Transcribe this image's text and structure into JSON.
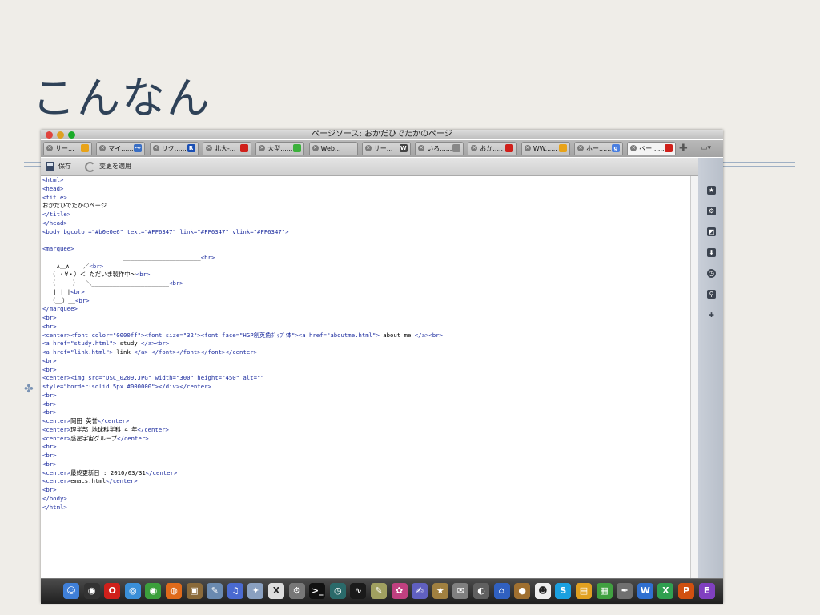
{
  "slide": {
    "title": "こんなん",
    "bullet": "✤"
  },
  "window": {
    "title": "ページソース: おかだひでたかのページ",
    "colors": {
      "close": "#e0443e",
      "minimize": "#dea123",
      "zoom": "#1aab29",
      "tag": "#1b2b9e",
      "text": "#000000"
    }
  },
  "tabs": [
    {
      "label": "サー...",
      "favicon": "tiles-icon",
      "fav_text": "",
      "fav_color": "#e8a319"
    },
    {
      "label": "マイ......",
      "favicon": "chart-icon",
      "fav_text": "〜",
      "fav_color": "#3a6fc4"
    },
    {
      "label": "リク......",
      "favicon": "r-icon",
      "fav_text": "R",
      "fav_color": "#1a4fb4"
    },
    {
      "label": "北大-...",
      "favicon": "bookmark-icon",
      "fav_text": "",
      "fav_color": "#d0201b"
    },
    {
      "label": "大型......",
      "favicon": "battery-icon",
      "fav_text": "",
      "fav_color": "#3cb13c"
    },
    {
      "label": "Web...",
      "favicon": "",
      "fav_text": "",
      "fav_color": ""
    },
    {
      "label": "サー...",
      "favicon": "wikipedia-icon",
      "fav_text": "W",
      "fav_color": "#444444"
    },
    {
      "label": "いろ......",
      "favicon": "doc-icon",
      "fav_text": "",
      "fav_color": "#888888"
    },
    {
      "label": "おか......",
      "favicon": "bookmark-icon",
      "fav_text": "",
      "fav_color": "#d0201b"
    },
    {
      "label": "WW......",
      "favicon": "tiles-icon",
      "fav_text": "",
      "fav_color": "#e8a319"
    },
    {
      "label": "ホー......",
      "favicon": "google-icon",
      "fav_text": "g",
      "fav_color": "#4a7fe0"
    },
    {
      "label": "ペー......",
      "favicon": "bookmark-icon",
      "fav_text": "",
      "fav_color": "#d0201b"
    }
  ],
  "toolbar": {
    "save_label": "保存",
    "apply_label": "変更を適用"
  },
  "source_lines": [
    [
      [
        "<html>",
        "tag"
      ]
    ],
    [
      [
        "<head>",
        "tag"
      ]
    ],
    [
      [
        "<title>",
        "tag"
      ]
    ],
    [
      [
        "おかだひでたかのページ",
        "text"
      ]
    ],
    [
      [
        "</title>",
        "tag"
      ]
    ],
    [
      [
        "</head>",
        "tag"
      ]
    ],
    [
      [
        "<body bgcolor=\"#b0e0e6\" text=\"#FF6347\" link=\"#FF6347\" vlink=\"#FF6347\">",
        "tag"
      ]
    ],
    [
      [
        "",
        "text"
      ]
    ],
    [
      [
        "<marquee>",
        "tag"
      ]
    ],
    [
      [
        "                       ______________________",
        "text"
      ],
      [
        "<br>",
        "tag"
      ]
    ],
    [
      [
        "    ∧＿∧    ／",
        "text"
      ],
      [
        "<br>",
        "tag"
      ]
    ],
    [
      [
        "  （ ・∀・）＜ ただいま製作中～",
        "text"
      ],
      [
        "<br>",
        "tag"
      ]
    ],
    [
      [
        "  （     ）  ＼______________________",
        "text"
      ],
      [
        "<br>",
        "tag"
      ]
    ],
    [
      [
        "   | | |",
        "text"
      ],
      [
        "<br>",
        "tag"
      ]
    ],
    [
      [
        "  （__）__",
        "text"
      ],
      [
        "<br>",
        "tag"
      ]
    ],
    [
      [
        "</marquee>",
        "tag"
      ]
    ],
    [
      [
        "<br>",
        "tag"
      ]
    ],
    [
      [
        "<br>",
        "tag"
      ]
    ],
    [
      [
        "<center><font color=\"0000ff\"><font size=\"32\"><font face=\"HGP創英角ﾎﾟｯﾌﾟ体\"><a href=\"aboutme.html\">",
        "tag"
      ],
      [
        " about me ",
        "text"
      ],
      [
        "</a><br>",
        "tag"
      ]
    ],
    [
      [
        "<a href=\"study.html\">",
        "tag"
      ],
      [
        " study ",
        "text"
      ],
      [
        "</a><br>",
        "tag"
      ]
    ],
    [
      [
        "<a href=\"link.html\">",
        "tag"
      ],
      [
        " link ",
        "text"
      ],
      [
        "</a> </font></font></font></center>",
        "tag"
      ]
    ],
    [
      [
        "<br>",
        "tag"
      ]
    ],
    [
      [
        "<br>",
        "tag"
      ]
    ],
    [
      [
        "<center><img src=\"DSC_0209.JPG\" width=\"300\" height=\"450\" alt=\"\"",
        "tag"
      ]
    ],
    [
      [
        "style=\"border:solid 5px #000000\"></div></center>",
        "tag"
      ]
    ],
    [
      [
        "<br>",
        "tag"
      ]
    ],
    [
      [
        "<br>",
        "tag"
      ]
    ],
    [
      [
        "<br>",
        "tag"
      ]
    ],
    [
      [
        "<center>",
        "tag"
      ],
      [
        "岡田 英誉",
        "text"
      ],
      [
        "</center>",
        "tag"
      ]
    ],
    [
      [
        "<center>",
        "tag"
      ],
      [
        "理学部 地球科学科 4 年",
        "text"
      ],
      [
        "</center>",
        "tag"
      ]
    ],
    [
      [
        "<center>",
        "tag"
      ],
      [
        "惑星宇宙グループ",
        "text"
      ],
      [
        "</center>",
        "tag"
      ]
    ],
    [
      [
        "<br>",
        "tag"
      ]
    ],
    [
      [
        "<br>",
        "tag"
      ]
    ],
    [
      [
        "<br>",
        "tag"
      ]
    ],
    [
      [
        "<center>",
        "tag"
      ],
      [
        "最終更新日 : 2010/03/31",
        "text"
      ],
      [
        "</center>",
        "tag"
      ]
    ],
    [
      [
        "<center>",
        "tag"
      ],
      [
        "emacs.html",
        "text"
      ],
      [
        "</center>",
        "tag"
      ]
    ],
    [
      [
        "<br>",
        "tag"
      ]
    ],
    [
      [
        "</body>",
        "tag"
      ]
    ],
    [
      [
        "</html>",
        "tag"
      ]
    ]
  ],
  "sidebar_icons": [
    "bookmark-star-icon",
    "gear-icon",
    "note-icon",
    "download-icon",
    "history-clock-icon",
    "search-icon",
    "add-icon"
  ],
  "dock_icons": [
    {
      "name": "finder-icon",
      "color": "#3f7fd8",
      "glyph": "☺"
    },
    {
      "name": "dashboard-icon",
      "color": "#333333",
      "glyph": "◉"
    },
    {
      "name": "opera-icon",
      "color": "#d0201b",
      "glyph": "O"
    },
    {
      "name": "safari-icon",
      "color": "#3a8fd8",
      "glyph": "◎"
    },
    {
      "name": "chrome-icon",
      "color": "#3c9f3c",
      "glyph": "◉"
    },
    {
      "name": "firefox-icon",
      "color": "#e06a1a",
      "glyph": "◍"
    },
    {
      "name": "photo-icon",
      "color": "#8a6a3a",
      "glyph": "▣"
    },
    {
      "name": "preview-icon",
      "color": "#6a8ab0",
      "glyph": "✎"
    },
    {
      "name": "itunes-icon",
      "color": "#4a6ad0",
      "glyph": "♫"
    },
    {
      "name": "app-icon",
      "color": "#8aa0c0",
      "glyph": "✦"
    },
    {
      "name": "x11-icon",
      "color": "#dddddd",
      "glyph": "X"
    },
    {
      "name": "preferences-icon",
      "color": "#777777",
      "glyph": "⚙"
    },
    {
      "name": "terminal-icon",
      "color": "#111111",
      "glyph": ">_"
    },
    {
      "name": "timemachine-icon",
      "color": "#2a6a6a",
      "glyph": "◷"
    },
    {
      "name": "activity-icon",
      "color": "#1a1a1a",
      "glyph": "∿"
    },
    {
      "name": "app-icon",
      "color": "#a0a060",
      "glyph": "✎"
    },
    {
      "name": "app-icon",
      "color": "#c04080",
      "glyph": "✿"
    },
    {
      "name": "app-icon",
      "color": "#6060c0",
      "glyph": "✍"
    },
    {
      "name": "app-icon",
      "color": "#a08040",
      "glyph": "★"
    },
    {
      "name": "app-icon",
      "color": "#808080",
      "glyph": "✉"
    },
    {
      "name": "app-icon",
      "color": "#606060",
      "glyph": "◐"
    },
    {
      "name": "app-icon",
      "color": "#3060c0",
      "glyph": "⌂"
    },
    {
      "name": "app-icon",
      "color": "#a07030",
      "glyph": "●"
    },
    {
      "name": "app-icon",
      "color": "#eeeeee",
      "glyph": "☻"
    },
    {
      "name": "skype-icon",
      "color": "#1aa0e0",
      "glyph": "S"
    },
    {
      "name": "app-icon",
      "color": "#e0a020",
      "glyph": "▤"
    },
    {
      "name": "app-icon",
      "color": "#40a040",
      "glyph": "▦"
    },
    {
      "name": "app-icon",
      "color": "#707070",
      "glyph": "✒"
    },
    {
      "name": "app-icon",
      "color": "#3070d0",
      "glyph": "W"
    },
    {
      "name": "app-icon",
      "color": "#30a050",
      "glyph": "X"
    },
    {
      "name": "app-icon",
      "color": "#d05010",
      "glyph": "P"
    },
    {
      "name": "app-icon",
      "color": "#8040c0",
      "glyph": "E"
    }
  ]
}
